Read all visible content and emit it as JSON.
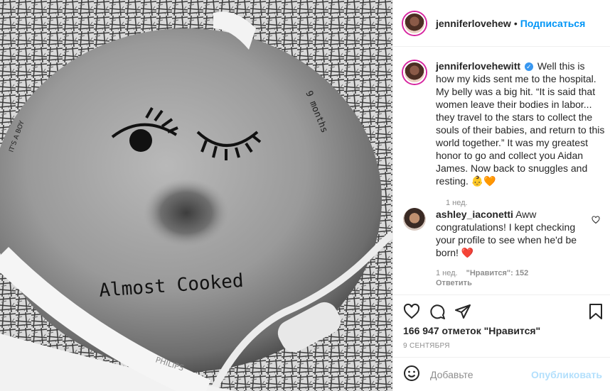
{
  "post_image": {
    "alt": "",
    "tattoo_text": "Almost Cooked",
    "side_text_left": "IT'S A BOY",
    "side_text_right": "9 months",
    "brand_text": "PHILIPS"
  },
  "header": {
    "username": "jenniferlovehew",
    "separator": "•",
    "follow_label": "Подписаться"
  },
  "caption": {
    "username": "jenniferlovehewitt",
    "verified_mark": "✓",
    "text": "Well this is how my kids sent me to the hospital. My belly was a big hit. “It is said that women leave their bodies in labor... they travel to the stars to collect the souls of their babies, and return to this world together.” It was my greatest honor to go and collect you Aidan James. Now back to snuggles and resting. 👶🧡",
    "time": "1 нед."
  },
  "comment": {
    "username": "ashley_iaconetti",
    "text": "Aww congratulations! I kept checking your profile to see when he'd be born! ❤️",
    "time": "1 нед.",
    "likes": "\"Нравится\": 152",
    "reply_label": "Ответить"
  },
  "actions": {
    "like_icon": "heart-icon",
    "comment_icon": "comment-icon",
    "share_icon": "paper-plane-icon",
    "save_icon": "bookmark-icon"
  },
  "likes_text": "166 947 отметок \"Нравится\"",
  "date_text": "9 СЕНТЯБРЯ",
  "add_comment": {
    "placeholder": "Добавьте",
    "publish_label": "Опубликовать"
  }
}
